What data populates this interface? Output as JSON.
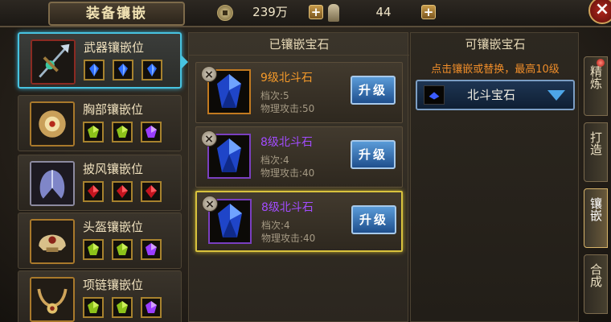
{
  "header": {
    "title": "装备镶嵌",
    "money": "239万",
    "stamina": "44",
    "plus_label": "+",
    "close_label": "×"
  },
  "slots": [
    {
      "label": "武器镶嵌位",
      "gems": [
        "blue",
        "blue",
        "blue"
      ],
      "selected": true
    },
    {
      "label": "胸部镶嵌位",
      "gems": [
        "green",
        "green",
        "purple"
      ],
      "selected": false
    },
    {
      "label": "披风镶嵌位",
      "gems": [
        "red",
        "red",
        "red"
      ],
      "selected": false
    },
    {
      "label": "头盔镶嵌位",
      "gems": [
        "green",
        "green",
        "purple"
      ],
      "selected": false
    },
    {
      "label": "项链镶嵌位",
      "gems": [
        "green",
        "green",
        "purple"
      ],
      "selected": false
    }
  ],
  "inlaid": {
    "header": "已镶嵌宝石",
    "items": [
      {
        "name": "9级北斗石",
        "grade": "档次:5",
        "attack": "物理攻击:50",
        "button": "升级",
        "name_color": "orange"
      },
      {
        "name": "8级北斗石",
        "grade": "档次:4",
        "attack": "物理攻击:40",
        "button": "升级",
        "name_color": "purple"
      },
      {
        "name": "8级北斗石",
        "grade": "档次:4",
        "attack": "物理攻击:40",
        "button": "升级",
        "name_color": "purple"
      }
    ]
  },
  "available": {
    "header": "可镶嵌宝石",
    "hint": "点击镶嵌或替换，最高10级",
    "selected": "北斗宝石"
  },
  "tabs": [
    "精炼",
    "打造",
    "镶嵌",
    "合成"
  ],
  "colors": {
    "accent_blue": "#47c3e0",
    "gem_orange": "#f59a2a",
    "gem_purple": "#a24cff",
    "hint_orange": "#ef8d2a"
  }
}
